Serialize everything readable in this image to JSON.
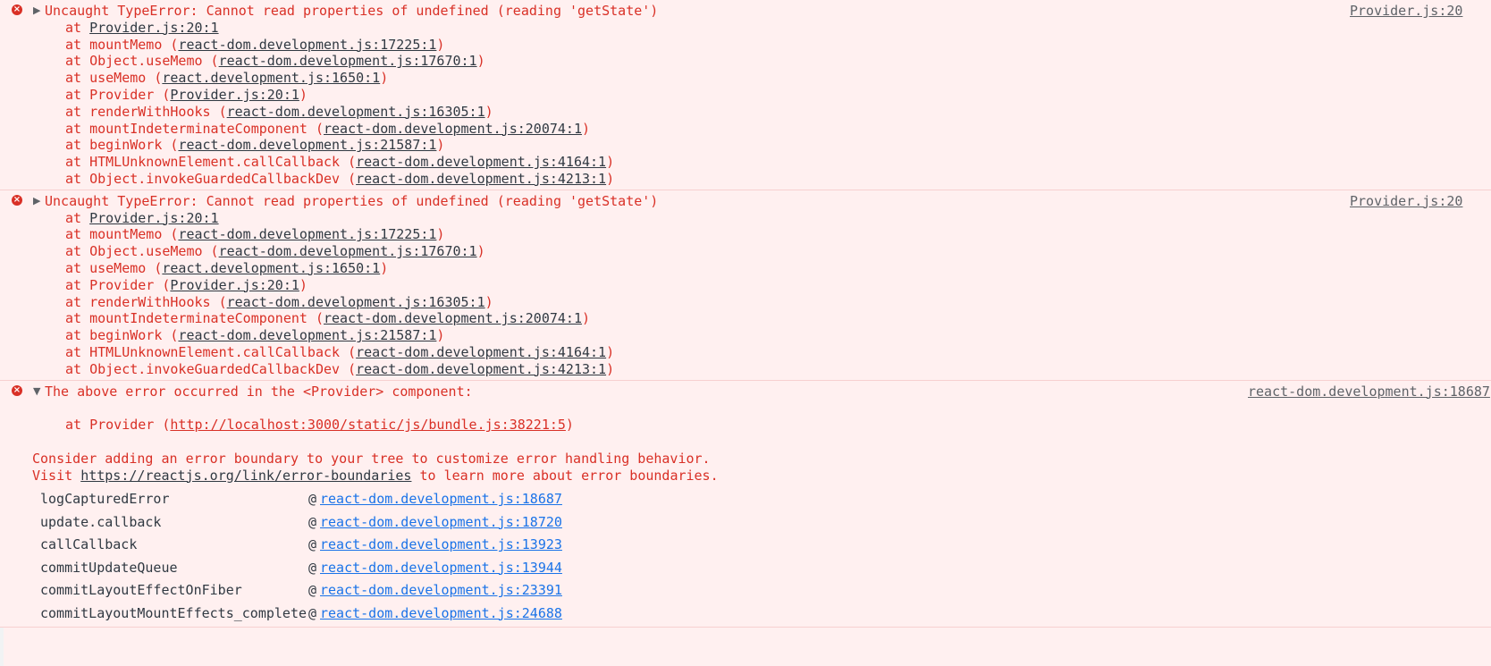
{
  "messages": [
    {
      "icon": "×",
      "toggle": "▶",
      "text": "Uncaught TypeError: Cannot read properties of undefined (reading 'getState')",
      "source": "Provider.js:20",
      "frames": [
        {
          "fn": "Provider.js:20:1",
          "link": ""
        },
        {
          "fn": "mountMemo",
          "link": "react-dom.development.js:17225:1"
        },
        {
          "fn": "Object.useMemo",
          "link": "react-dom.development.js:17670:1"
        },
        {
          "fn": "useMemo",
          "link": "react.development.js:1650:1"
        },
        {
          "fn": "Provider",
          "link": "Provider.js:20:1"
        },
        {
          "fn": "renderWithHooks",
          "link": "react-dom.development.js:16305:1"
        },
        {
          "fn": "mountIndeterminateComponent",
          "link": "react-dom.development.js:20074:1"
        },
        {
          "fn": "beginWork",
          "link": "react-dom.development.js:21587:1"
        },
        {
          "fn": "HTMLUnknownElement.callCallback",
          "link": "react-dom.development.js:4164:1"
        },
        {
          "fn": "Object.invokeGuardedCallbackDev",
          "link": "react-dom.development.js:4213:1"
        }
      ]
    },
    {
      "icon": "×",
      "toggle": "▶",
      "text": "Uncaught TypeError: Cannot read properties of undefined (reading 'getState')",
      "source": "Provider.js:20",
      "frames": [
        {
          "fn": "Provider.js:20:1",
          "link": ""
        },
        {
          "fn": "mountMemo",
          "link": "react-dom.development.js:17225:1"
        },
        {
          "fn": "Object.useMemo",
          "link": "react-dom.development.js:17670:1"
        },
        {
          "fn": "useMemo",
          "link": "react.development.js:1650:1"
        },
        {
          "fn": "Provider",
          "link": "Provider.js:20:1"
        },
        {
          "fn": "renderWithHooks",
          "link": "react-dom.development.js:16305:1"
        },
        {
          "fn": "mountIndeterminateComponent",
          "link": "react-dom.development.js:20074:1"
        },
        {
          "fn": "beginWork",
          "link": "react-dom.development.js:21587:1"
        },
        {
          "fn": "HTMLUnknownElement.callCallback",
          "link": "react-dom.development.js:4164:1"
        },
        {
          "fn": "Object.invokeGuardedCallbackDev",
          "link": "react-dom.development.js:4213:1"
        }
      ]
    }
  ],
  "boundary": {
    "icon": "×",
    "toggle": "▼",
    "text": "The above error occurred in the <Provider> component:",
    "source": "react-dom.development.js:18687",
    "frame_prefix": "at Provider (",
    "frame_link": "http://localhost:3000/static/js/bundle.js:38221:5",
    "frame_suffix": ")",
    "consider": "Consider adding an error boundary to your tree to customize error handling behavior.",
    "visit_prefix": "Visit ",
    "visit_link": "https://reactjs.org/link/error-boundaries",
    "visit_suffix": " to learn more about error boundaries.",
    "stack": [
      {
        "fn": "logCapturedError",
        "link": "react-dom.development.js:18687"
      },
      {
        "fn": "update.callback",
        "link": "react-dom.development.js:18720"
      },
      {
        "fn": "callCallback",
        "link": "react-dom.development.js:13923"
      },
      {
        "fn": "commitUpdateQueue",
        "link": "react-dom.development.js:13944"
      },
      {
        "fn": "commitLayoutEffectOnFiber",
        "link": "react-dom.development.js:23391"
      },
      {
        "fn": "commitLayoutMountEffects_complete",
        "link": "react-dom.development.js:24688"
      }
    ]
  },
  "colors": {
    "error": "#d93026",
    "link": "#1a73e8",
    "background": "#fff0f0"
  }
}
